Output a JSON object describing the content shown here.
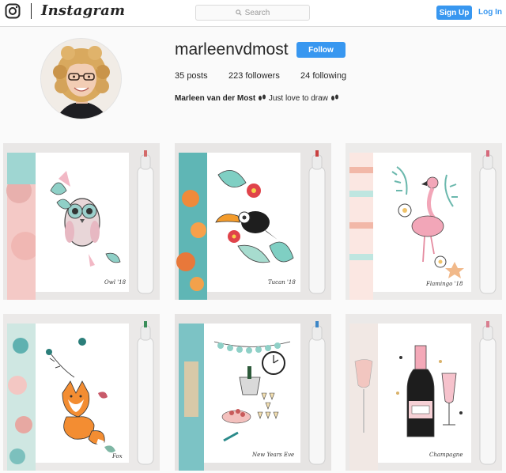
{
  "nav": {
    "brand": "Instagram",
    "search_placeholder": "Search",
    "signup_label": "Sign Up",
    "login_label": "Log In"
  },
  "profile": {
    "username": "marleenvdmost",
    "follow_label": "Follow",
    "posts_count": "35",
    "posts_label": "posts",
    "followers_count": "223",
    "followers_label": "followers",
    "following_count": "24",
    "following_label": "following",
    "full_name": "Marleen van der Most",
    "bio_text": "Just love to draw"
  },
  "posts": [
    {
      "caption": "Owl '18",
      "subject": "owl"
    },
    {
      "caption": "Tucan '18",
      "subject": "toucan"
    },
    {
      "caption": "Flamingo '18",
      "subject": "flamingo"
    },
    {
      "caption": "Fox",
      "subject": "fox"
    },
    {
      "caption": "New Years Eve",
      "subject": "new-years-eve"
    },
    {
      "caption": "Champagne",
      "subject": "champagne"
    }
  ],
  "colors": {
    "accent": "#3897f0",
    "border": "#dbdbdb",
    "background": "#fafafa"
  }
}
